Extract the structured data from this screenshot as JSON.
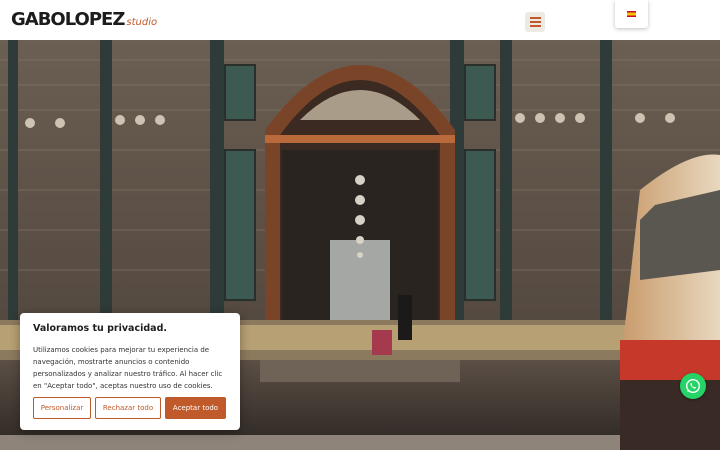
{
  "header": {
    "logo_main": "GABOLOPEZ",
    "logo_sub": "studio",
    "menu_icon": "hamburger-menu-icon",
    "language_flag": "spain-flag-icon"
  },
  "hero": {
    "image_description_icon": "market-hall-photo"
  },
  "cookie_banner": {
    "title": "Valoramos tu privacidad.",
    "text": "Utilizamos cookies para mejorar tu experiencia de navegación, mostrarte anuncios o contenido personalizados y analizar nuestro tráfico. Al hacer clic en \"Aceptar todo\", aceptas nuestro uso de cookies.",
    "customize_label": "Personalizar",
    "reject_label": "Rechazar todo",
    "accept_label": "Aceptar todo"
  },
  "floating": {
    "whatsapp_icon": "whatsapp-icon"
  },
  "colors": {
    "accent": "#c05a2a",
    "whatsapp": "#25d366"
  }
}
